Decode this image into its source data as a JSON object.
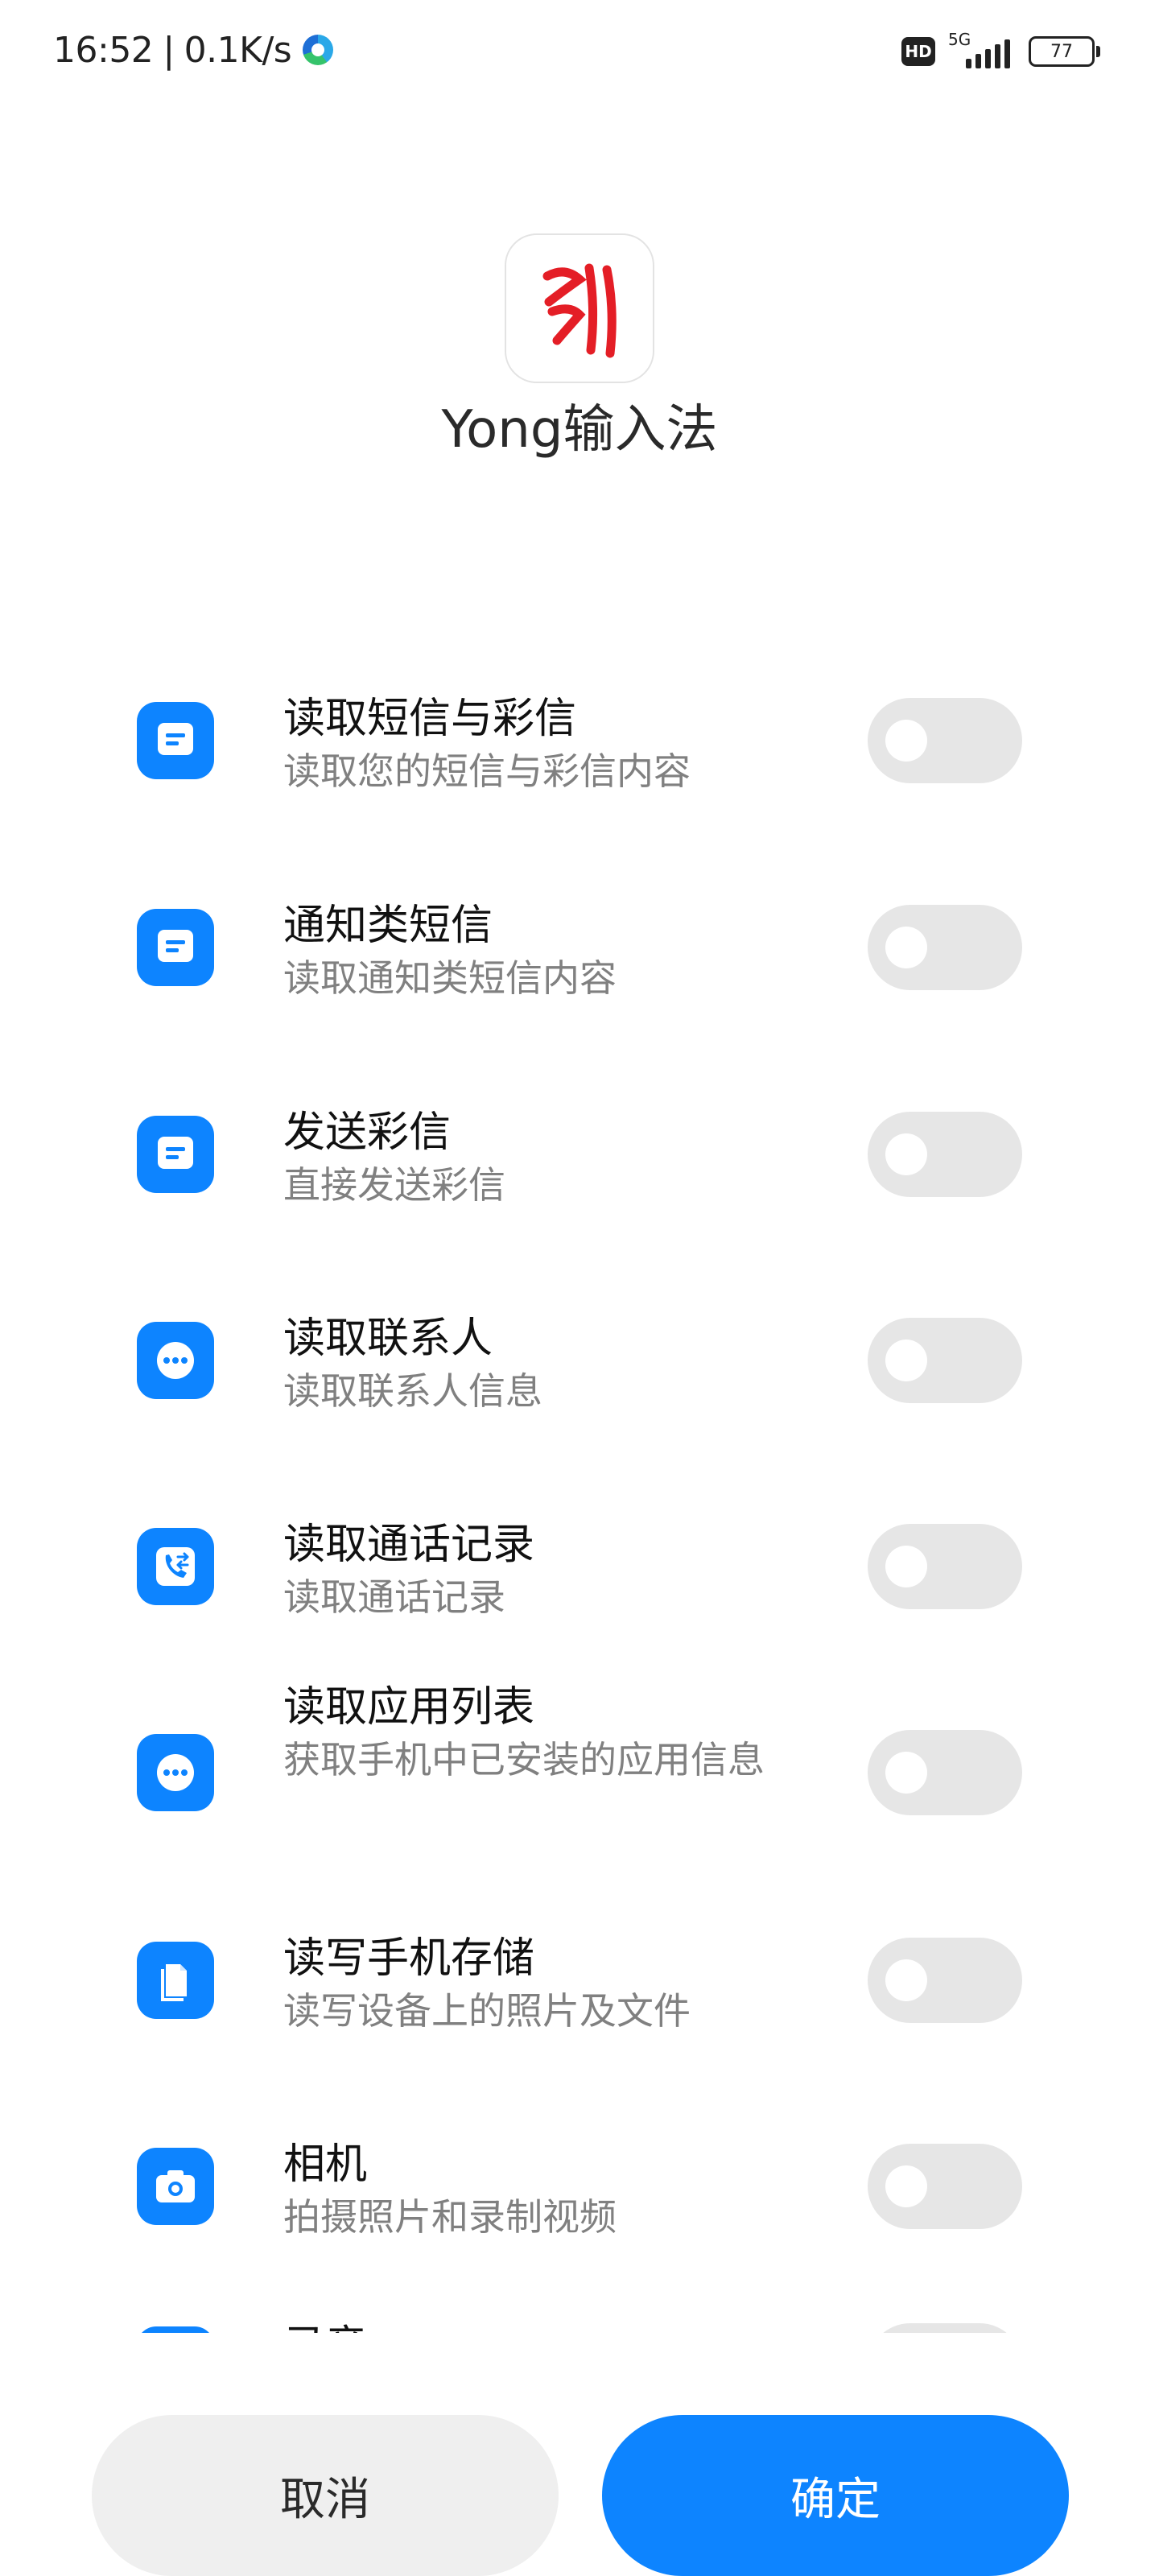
{
  "status_bar": {
    "time": "16:52",
    "separator": "|",
    "net_speed": "0.1K/s",
    "hd": "HD",
    "network": "5G",
    "battery": "77",
    "browser_icon": "edge-browser-icon"
  },
  "app": {
    "name": "Yong输入法",
    "icon": "yong-logo-icon",
    "logo_color": "#e41e26"
  },
  "permissions": [
    {
      "icon": "message-icon",
      "title": "读取短信与彩信",
      "desc": "读取您的短信与彩信内容",
      "enabled": false
    },
    {
      "icon": "message-icon",
      "title": "通知类短信",
      "desc": "读取通知类短信内容",
      "enabled": false
    },
    {
      "icon": "message-icon",
      "title": "发送彩信",
      "desc": "直接发送彩信",
      "enabled": false
    },
    {
      "icon": "more-dots-icon",
      "title": "读取联系人",
      "desc": "读取联系人信息",
      "enabled": false
    },
    {
      "icon": "phone-transfer-icon",
      "title": "读取通话记录",
      "desc": "读取通话记录",
      "enabled": false
    },
    {
      "icon": "more-dots-icon",
      "title": "读取应用列表",
      "desc": "获取手机中已安装的应用信息",
      "enabled": false
    },
    {
      "icon": "files-icon",
      "title": "读写手机存储",
      "desc": "读写设备上的照片及文件",
      "enabled": false
    },
    {
      "icon": "camera-icon",
      "title": "相机",
      "desc": "拍摄照片和录制视频",
      "enabled": false
    },
    {
      "icon": "microphone-icon",
      "title": "录音",
      "desc": "",
      "enabled": false
    }
  ],
  "buttons": {
    "cancel": "取消",
    "confirm": "确定"
  },
  "colors": {
    "accent": "#0d84ff",
    "toggle_off": "#e6e6e6",
    "cancel_bg": "#efefef"
  }
}
